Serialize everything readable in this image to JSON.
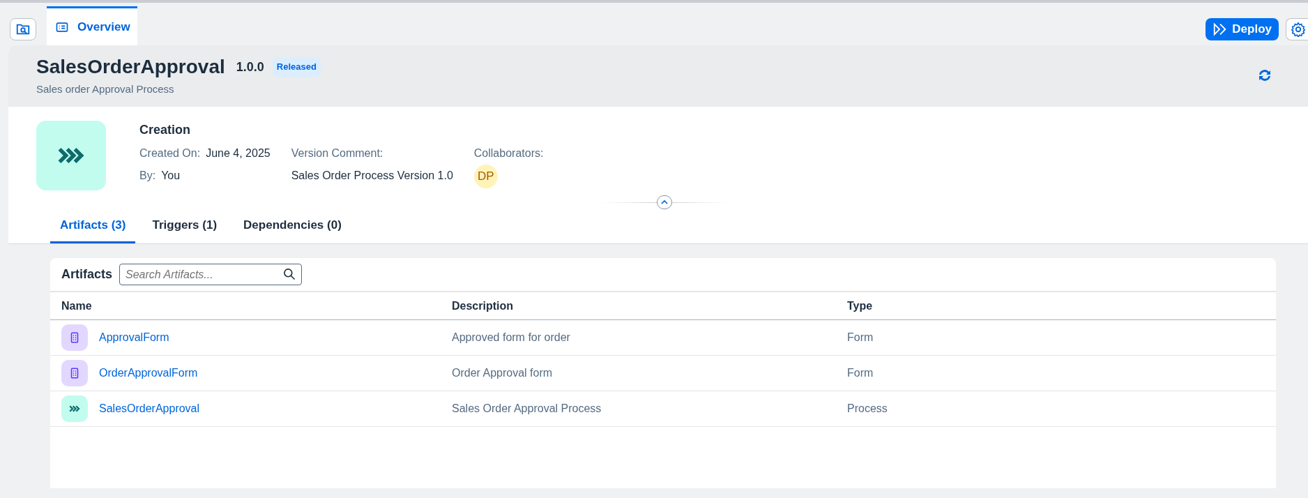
{
  "top_tabs": [
    {
      "label": "Overview",
      "selected": true
    }
  ],
  "deploy_button": "Deploy",
  "header": {
    "title": "SalesOrderApproval",
    "version": "1.0.0",
    "status": "Released",
    "subtitle": "Sales order Approval Process"
  },
  "info": {
    "heading": "Creation",
    "created_on_label": "Created On:",
    "created_on": "June 4, 2025",
    "by_label": "By:",
    "by": "You",
    "version_comment_label": "Version Comment:",
    "version_comment": "Sales Order Process Version 1.0",
    "collaborators_label": "Collaborators:",
    "collaborators": [
      {
        "initials": "DP"
      }
    ]
  },
  "section_tabs": [
    {
      "label": "Artifacts (3)",
      "selected": true
    },
    {
      "label": "Triggers (1)",
      "selected": false
    },
    {
      "label": "Dependencies (0)",
      "selected": false
    }
  ],
  "artifacts": {
    "title": "Artifacts",
    "search": {
      "placeholder": "Search Artifacts..."
    },
    "columns": [
      "Name",
      "Description",
      "Type"
    ],
    "rows": [
      {
        "kind": "form",
        "name": "ApprovalForm",
        "description": "Approved form for order",
        "type": "Form"
      },
      {
        "kind": "form",
        "name": "OrderApprovalForm",
        "description": "Order Approval form",
        "type": "Form"
      },
      {
        "kind": "process",
        "name": "SalesOrderApproval",
        "description": "Sales Order Approval Process",
        "type": "Process"
      }
    ]
  }
}
